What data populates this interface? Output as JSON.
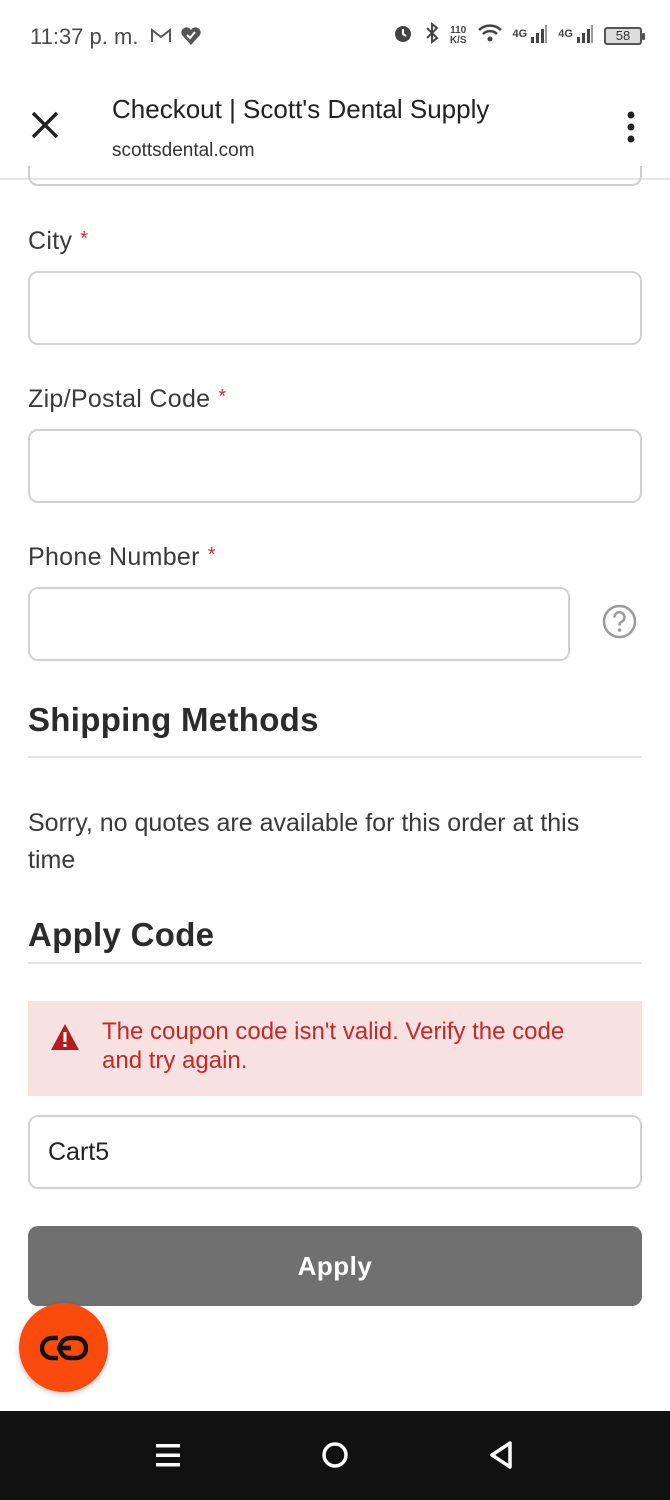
{
  "status_bar": {
    "time": "11:37 p. m.",
    "speed_value": "110",
    "speed_unit": "K/S",
    "net1": "4G",
    "net2": "4G",
    "battery": "58",
    "icons": [
      "gmail-icon",
      "heart-app-icon",
      "alarm-icon",
      "bluetooth-icon",
      "wifi-icon",
      "signal-icon",
      "signal-icon",
      "battery-icon"
    ]
  },
  "browser": {
    "title": "Checkout | Scott's Dental Supply",
    "url": "scottsdental.com",
    "icons": [
      "close-icon",
      "more-vert-icon"
    ]
  },
  "form": {
    "required_mark": "*",
    "city": {
      "label": "City",
      "value": ""
    },
    "zip": {
      "label": "Zip/Postal Code",
      "value": ""
    },
    "phone": {
      "label": "Phone Number",
      "value": "",
      "help_icon": "question-circle-icon"
    }
  },
  "shipping": {
    "title": "Shipping Methods",
    "message": "Sorry, no quotes are available for this order at this time"
  },
  "coupon": {
    "title": "Apply Code",
    "error": "The coupon code isn't valid. Verify the code and try again.",
    "error_icon": "warning-triangle-icon",
    "code_value": "Cart5",
    "apply_label": "Apply"
  },
  "fab": {
    "icon": "chat-link-icon"
  },
  "nav": {
    "icons": [
      "recents-icon",
      "home-icon",
      "back-icon"
    ]
  },
  "colors": {
    "required": "#d0342c",
    "error_text": "#c62828",
    "error_bg": "#f8e1e1",
    "apply_button": "#707070",
    "fab": "#fa4a0c",
    "nav_bg": "#111111"
  }
}
